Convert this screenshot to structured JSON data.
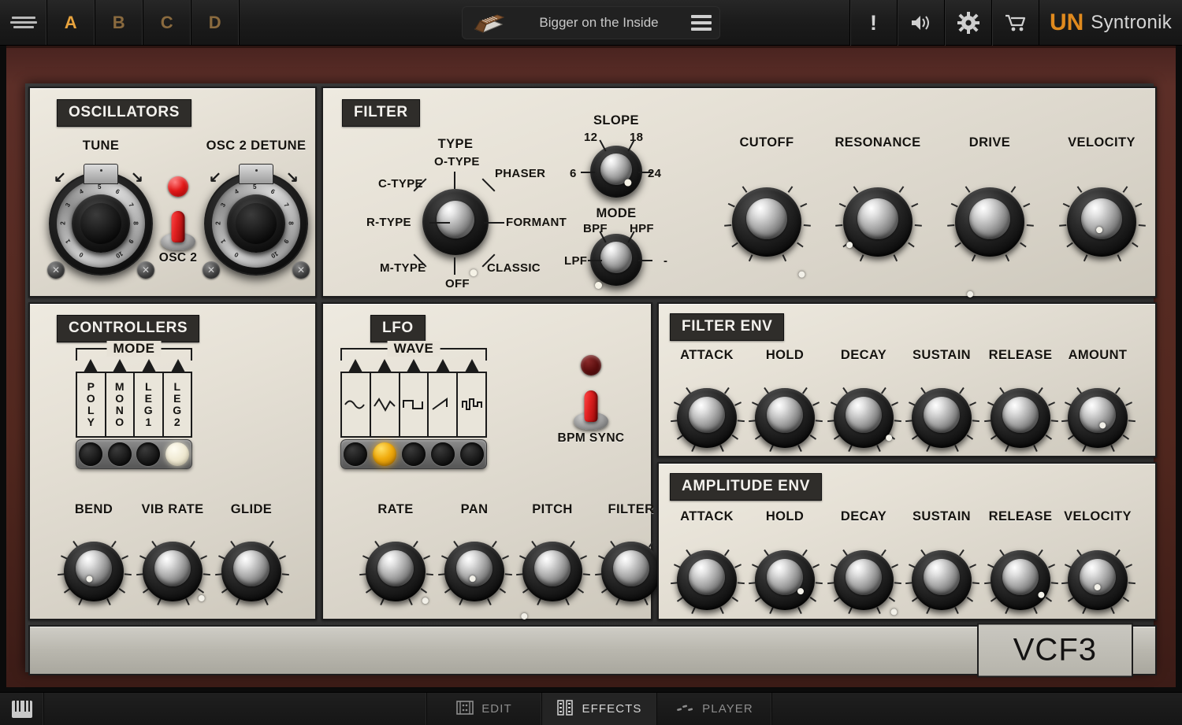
{
  "topbar": {
    "menu_icon": "hamburger-icon",
    "part_tabs": [
      {
        "label": "A",
        "active": true
      },
      {
        "label": "B",
        "active": false
      },
      {
        "label": "C",
        "active": false
      },
      {
        "label": "D",
        "active": false
      }
    ],
    "preset": {
      "name": "Bigger on the Inside",
      "instrument_icon": "synth-keyboard-icon",
      "list_icon": "preset-list-icon"
    },
    "right_icons": [
      {
        "name": "alert-icon",
        "glyph": "!"
      },
      {
        "name": "speaker-icon",
        "glyph": "speaker"
      },
      {
        "name": "gear-icon",
        "glyph": "gear"
      },
      {
        "name": "cart-icon",
        "glyph": "cart"
      }
    ],
    "brand": {
      "mark": "UN",
      "name": "Syntronik"
    }
  },
  "oscillators": {
    "title": "OSCILLATORS",
    "knobs": [
      {
        "label": "TUNE",
        "value_angle": 0
      },
      {
        "label": "OSC 2 DETUNE",
        "value_angle": 0
      }
    ],
    "led": {
      "name": "osc2-led",
      "state": "on",
      "color": "#e11818"
    },
    "switch": {
      "label": "OSC 2",
      "state": "up"
    }
  },
  "filter": {
    "title": "FILTER",
    "type": {
      "label": "TYPE",
      "options": [
        "O-TYPE",
        "PHASER",
        "FORMANT",
        "CLASSIC",
        "OFF",
        "M-TYPE",
        "R-TYPE",
        "C-TYPE"
      ],
      "selected": "CLASSIC"
    },
    "slope": {
      "label": "SLOPE",
      "options": [
        "6",
        "12",
        "18",
        "24"
      ],
      "selected": "18"
    },
    "mode": {
      "label": "MODE",
      "options": [
        "LPF",
        "BPF",
        "HPF",
        "-"
      ],
      "selected": "LPF"
    },
    "knobs": [
      {
        "label": "CUTOFF",
        "angle": 105
      },
      {
        "label": "RESONANCE",
        "angle": -55
      },
      {
        "label": "DRIVE",
        "angle": -145
      },
      {
        "label": "VELOCITY",
        "angle": -5
      }
    ]
  },
  "controllers": {
    "title": "CONTROLLERS",
    "mode": {
      "label": "MODE",
      "buttons": [
        "POLY",
        "MONO",
        "LEG 1",
        "LEG 2"
      ],
      "selected": "LEG 2"
    },
    "knobs": [
      {
        "label": "BEND",
        "angle": -10
      },
      {
        "label": "VIB RATE",
        "angle": 70
      },
      {
        "label": "GLIDE",
        "angle": -160
      }
    ]
  },
  "lfo": {
    "title": "LFO",
    "wave": {
      "label": "WAVE",
      "shapes": [
        "sine",
        "triangle",
        "square",
        "saw",
        "random"
      ],
      "selected": "triangle"
    },
    "bpm_sync": {
      "label": "BPM SYNC",
      "led": "off",
      "switch": "up"
    },
    "knobs": [
      {
        "label": "RATE",
        "angle": 75
      },
      {
        "label": "PAN",
        "angle": -5
      },
      {
        "label": "PITCH",
        "angle": -105
      },
      {
        "label": "FILTER",
        "angle": 150
      }
    ]
  },
  "filter_env": {
    "title": "FILTER ENV",
    "knobs": [
      {
        "label": "ATTACK",
        "angle": -160
      },
      {
        "label": "HOLD",
        "angle": -158
      },
      {
        "label": "DECAY",
        "angle": 55
      },
      {
        "label": "SUSTAIN",
        "angle": 155
      },
      {
        "label": "RELEASE",
        "angle": 157
      },
      {
        "label": "AMOUNT",
        "angle": 8
      }
    ]
  },
  "amplitude_env": {
    "title": "AMPLITUDE ENV",
    "knobs": [
      {
        "label": "ATTACK",
        "angle": -158
      },
      {
        "label": "HOLD",
        "angle": 30
      },
      {
        "label": "DECAY",
        "angle": 80
      },
      {
        "label": "SUSTAIN",
        "angle": 155
      },
      {
        "label": "RELEASE",
        "angle": 42
      },
      {
        "label": "VELOCITY",
        "angle": -2
      }
    ]
  },
  "nameplate": {
    "model": "VCF3"
  },
  "bottombar": {
    "keyboard_icon": "piano-keys-icon",
    "tabs": [
      {
        "label": "EDIT",
        "icon": "edit-grid-icon",
        "active": false
      },
      {
        "label": "EFFECTS",
        "icon": "effects-rack-icon",
        "active": true
      },
      {
        "label": "PLAYER",
        "icon": "player-notes-icon",
        "active": false
      }
    ]
  },
  "colors": {
    "accent": "#e8a33d",
    "brand_orange": "#e08a1e",
    "panel_cream": "#e7e2d7",
    "wood": "#5d2f28",
    "led_red": "#e11818",
    "led_amber": "#f0ab0d"
  }
}
